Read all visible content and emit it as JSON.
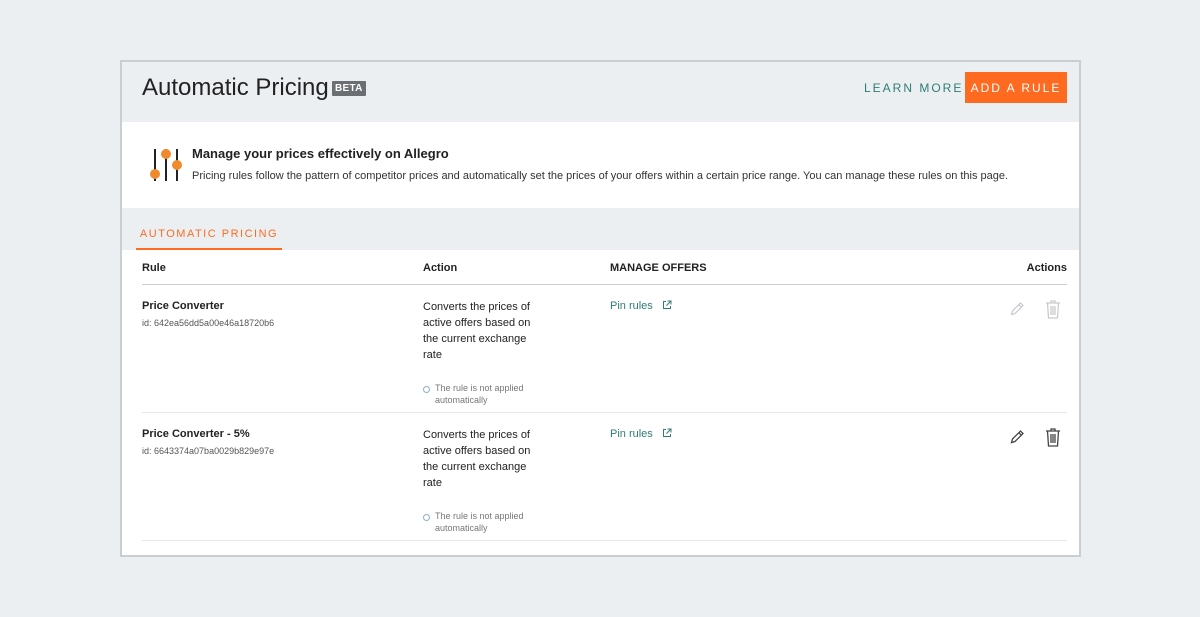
{
  "header": {
    "title": "Automatic Pricing",
    "badge": "BETA",
    "learn_more": "LEARN MORE",
    "add_rule": "ADD A RULE"
  },
  "info": {
    "icon": "sliders-icon",
    "title": "Manage your prices effectively on Allegro",
    "description": "Pricing rules follow the pattern of competitor prices and automatically set the prices of your offers within a certain price range. You can manage these rules on this page."
  },
  "tabs": [
    {
      "label": "AUTOMATIC PRICING",
      "active": true
    }
  ],
  "table": {
    "headers": {
      "rule": "Rule",
      "action": "Action",
      "manage": "MANAGE OFFERS",
      "actions": "Actions"
    },
    "rows": [
      {
        "name": "Price Converter",
        "id": "id: 642ea56dd5a00e46a18720b6",
        "action": "Converts the prices of active offers based on the current exchange rate",
        "note": "The rule is not applied automatically",
        "pin_rules": "Pin rules",
        "actions_enabled": false
      },
      {
        "name": "Price Converter - 5%",
        "id": "id: 6643374a07ba0029b829e97e",
        "action": "Converts the prices of active offers based on the current exchange rate",
        "note": "The rule is not applied automatically",
        "pin_rules": "Pin rules",
        "actions_enabled": true
      }
    ]
  },
  "colors": {
    "accent": "#ff6a21",
    "link": "#2f7d74",
    "background": "#eceff2"
  }
}
